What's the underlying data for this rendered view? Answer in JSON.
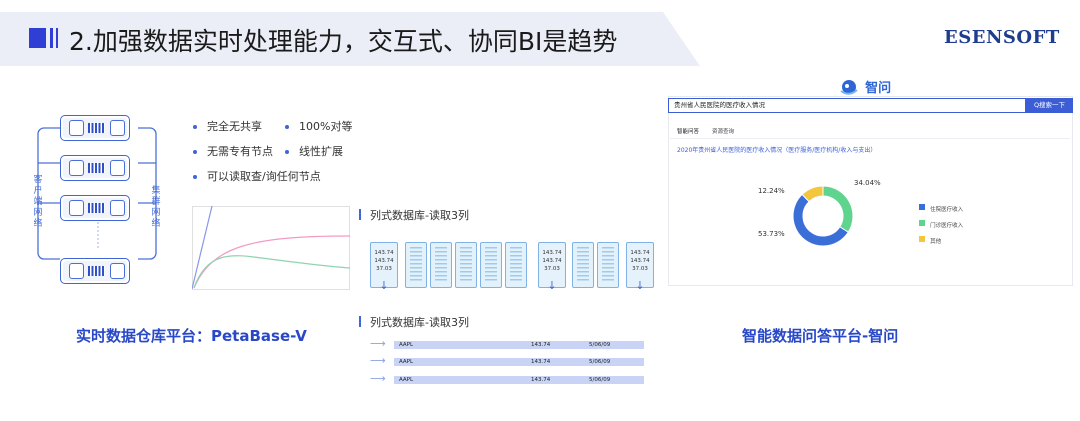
{
  "header": {
    "title": "2.加强数据实时处理能力，交互式、协同BI是趋势",
    "logo": "ESENSOFT"
  },
  "left": {
    "side_labels": {
      "left": "客户端网络",
      "right": "集群网络"
    },
    "bullets": [
      "完全无共享",
      "100%对等",
      "无需专有节点",
      "线性扩展",
      "可以读取查/询任何节点"
    ],
    "caption": "实时数据仓库平台：PetaBase-V"
  },
  "middle": {
    "columnar_title": "列式数据库-读取3列",
    "row_title": "列式数据库-读取3列",
    "cell_values": [
      "143.74",
      "143.74",
      "37.03"
    ],
    "rows": [
      {
        "name": "AAPL",
        "value": "143.74",
        "date": "5/06/09"
      },
      {
        "name": "AAPL",
        "value": "143.74",
        "date": "5/06/09"
      },
      {
        "name": "AAPL",
        "value": "143.74",
        "date": "5/06/09"
      }
    ]
  },
  "right": {
    "brand": "智问",
    "search_value": "贵州省人民医院的医疗收入情况",
    "search_button": "Q搜索一下",
    "tabs": [
      "智能问答",
      "资源查询"
    ],
    "subtitle": "2020年贵州省人民医院的医疗收入情况（医疗服务/医疗机构/收入与支出）",
    "caption": "智能数据问答平台-智问",
    "chart_data": {
      "type": "pie",
      "categories": [
        "住院医疗收入",
        "门诊医疗收入",
        "其他"
      ],
      "values": [
        53.73,
        34.04,
        12.24
      ],
      "value_labels": [
        "53.73%",
        "34.04%",
        "12.24%"
      ],
      "colors": [
        "#3b6fd8",
        "#5fd48e",
        "#f4c63d"
      ],
      "donut": true,
      "legend": "right"
    }
  },
  "colors": {
    "accent": "#2f3fd6",
    "caption": "#2848c8",
    "logo": "#1e3d8f"
  }
}
